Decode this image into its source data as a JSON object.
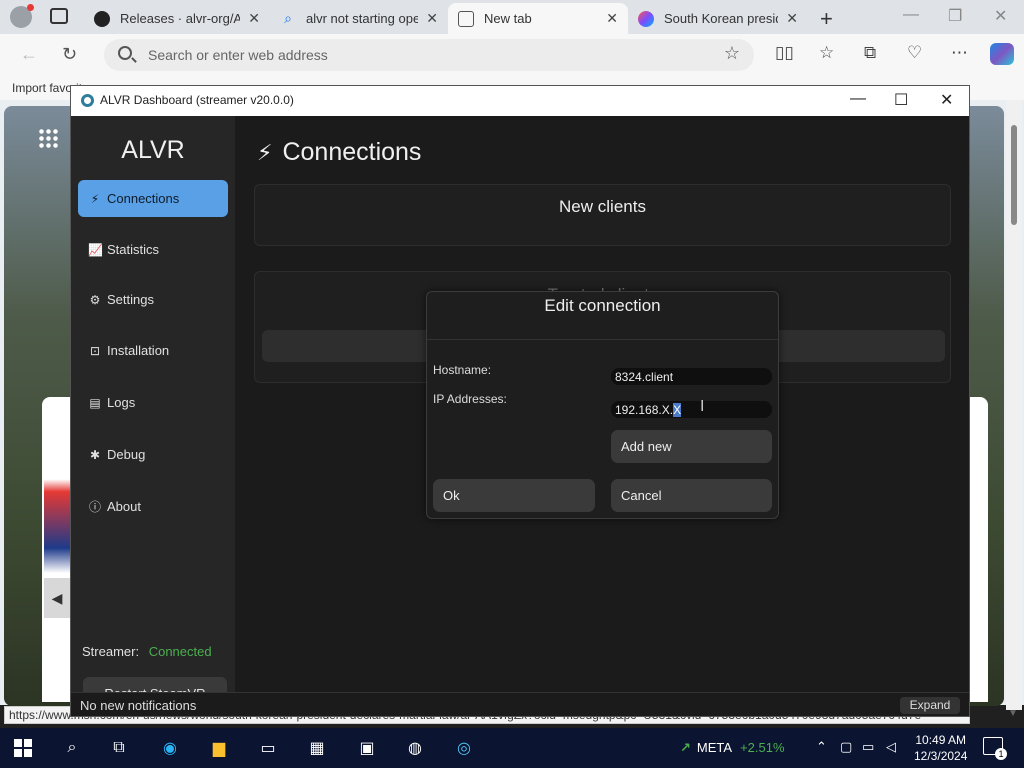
{
  "browser": {
    "tabs": [
      {
        "title": "Releases · alvr-org/ALVR"
      },
      {
        "title": "alvr not starting openvr"
      },
      {
        "title": "New tab"
      },
      {
        "title": "South Korean president"
      }
    ],
    "address_placeholder": "Search or enter web address",
    "favorites_item": "Import favorites",
    "status_url": "https://www.msn.com/en-us/news/world/south-korean-president-declares-martial-law/ar-AA1vfgZx?ocid=msedgntp&pc=U531&cvid=6753e6b1a0d5470e98d7ad05ae7c4d7e"
  },
  "alvr": {
    "window_title": "ALVR Dashboard (streamer v20.0.0)",
    "brand": "ALVR",
    "nav": [
      {
        "label": "Connections",
        "icon": "plug-icon"
      },
      {
        "label": "Statistics",
        "icon": "chart-icon"
      },
      {
        "label": "Settings",
        "icon": "gear-icon"
      },
      {
        "label": "Installation",
        "icon": "box-icon"
      },
      {
        "label": "Logs",
        "icon": "document-icon"
      },
      {
        "label": "Debug",
        "icon": "bug-icon"
      },
      {
        "label": "About",
        "icon": "info-icon"
      }
    ],
    "streamer_label": "Streamer:",
    "streamer_status": "Connected",
    "restart_button": "Restart SteamVR",
    "page_title": "Connections",
    "new_clients_header": "New clients",
    "trusted_clients_header": "Trusted clients",
    "notification": "No new notifications",
    "expand_button": "Expand",
    "dialog": {
      "title": "Edit connection",
      "hostname_label": "Hostname:",
      "hostname_value": "8324.client",
      "ip_label": "IP Addresses:",
      "ip_value_unselected": "192.168.X.",
      "ip_value_selected": "X",
      "add_new": "Add new",
      "ok": "Ok",
      "cancel": "Cancel"
    }
  },
  "taskbar": {
    "stock_symbol": "META",
    "stock_change": "+2.51%",
    "time": "10:49 AM",
    "date": "12/3/2024",
    "notification_count": "1"
  },
  "colors": {
    "accent_blue": "#5aa0e6",
    "connected_green": "#4caf50",
    "selection": "#4a7ac8"
  }
}
